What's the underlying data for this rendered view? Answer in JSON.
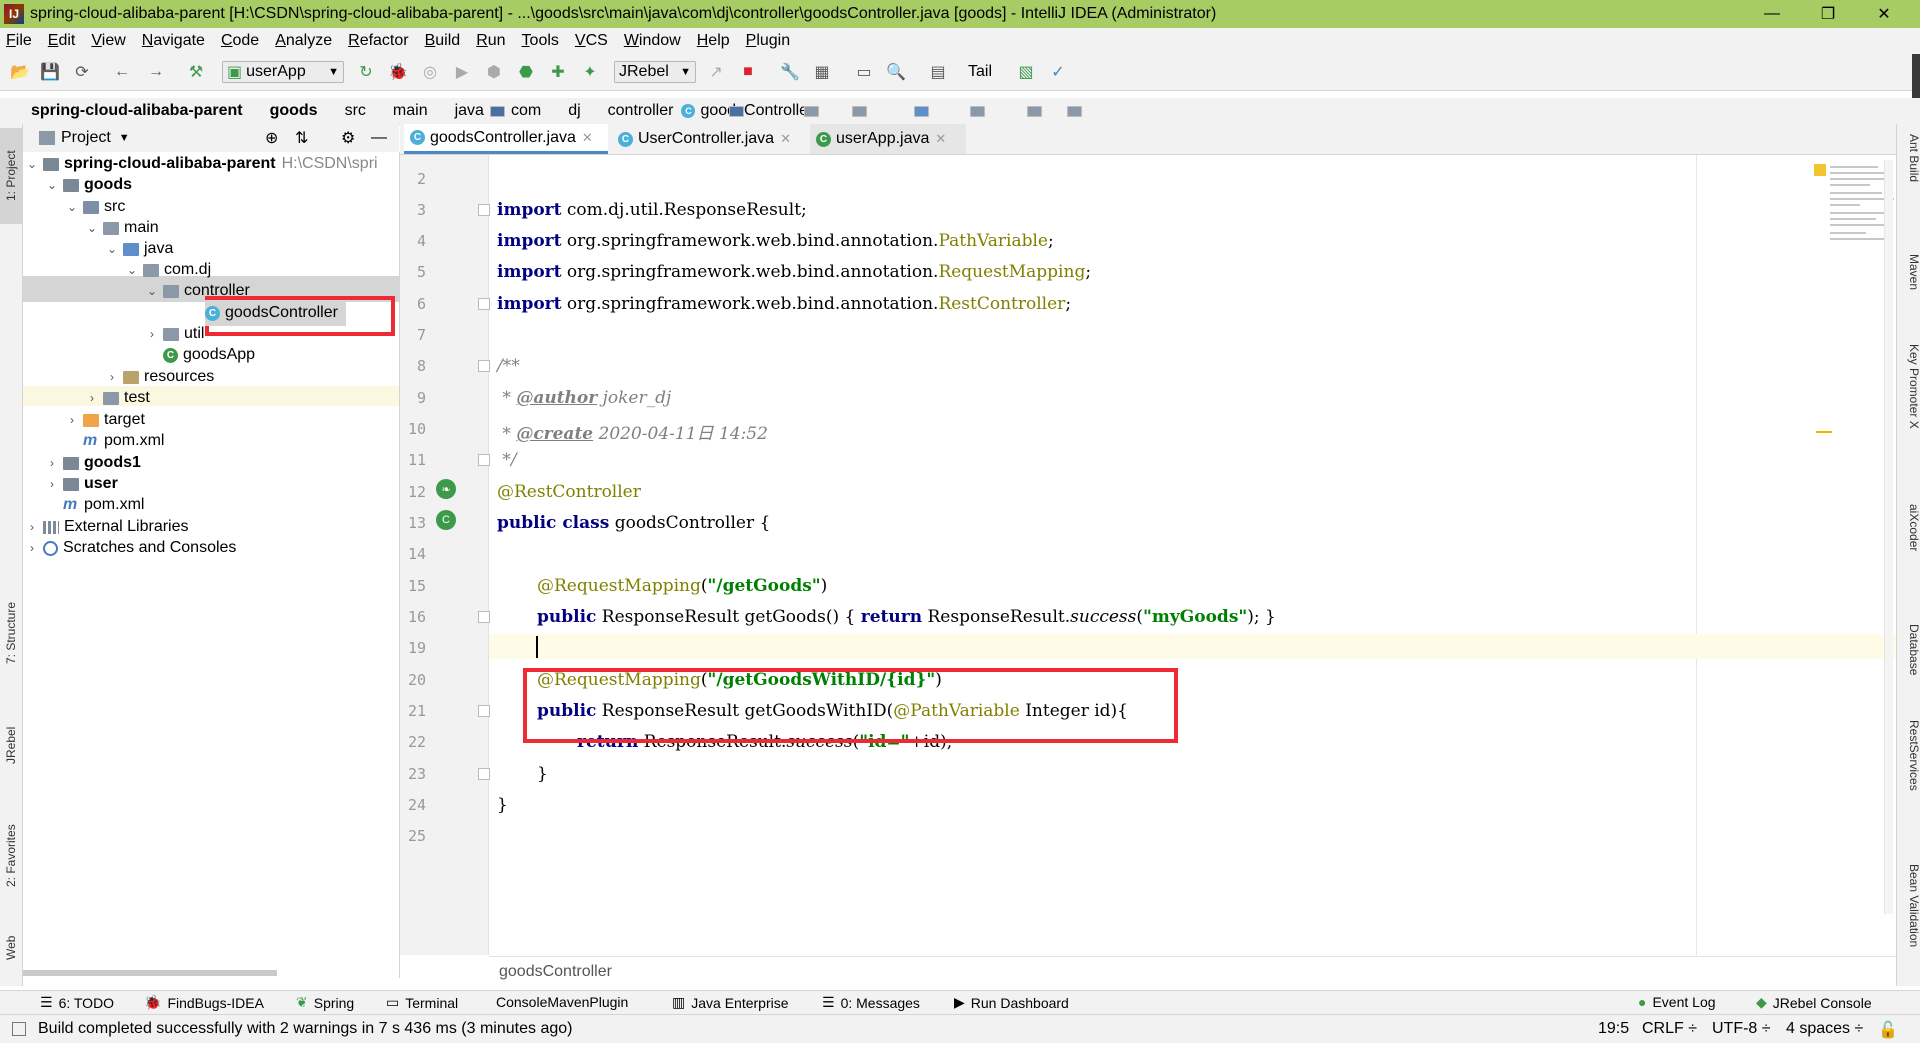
{
  "window": {
    "title": "spring-cloud-alibaba-parent [H:\\CSDN\\spring-cloud-alibaba-parent] - ...\\goods\\src\\main\\java\\com\\dj\\controller\\goodsController.java [goods] - IntelliJ IDEA (Administrator)",
    "app_icon": "IJ",
    "controls": [
      "—",
      "❐",
      "✕"
    ]
  },
  "menu": [
    "File",
    "Edit",
    "View",
    "Navigate",
    "Code",
    "Analyze",
    "Refactor",
    "Build",
    "Run",
    "Tools",
    "VCS",
    "Window",
    "Help",
    "Plugin"
  ],
  "toolbar": {
    "run_config": "userApp",
    "jrebel": "JRebel",
    "tail": "Tail"
  },
  "breadcrumb": [
    "spring-cloud-alibaba-parent",
    "goods",
    "src",
    "main",
    "java",
    "com",
    "dj",
    "controller",
    "goodsController"
  ],
  "project": {
    "header": "Project",
    "tree": [
      {
        "label": "spring-cloud-alibaba-parent",
        "hint": "H:\\CSDN\\spri",
        "bold": true
      },
      {
        "label": "goods",
        "bold": true
      },
      {
        "label": "src"
      },
      {
        "label": "main"
      },
      {
        "label": "java"
      },
      {
        "label": "com.dj"
      },
      {
        "label": "controller"
      },
      {
        "label": "goodsController"
      },
      {
        "label": "util"
      },
      {
        "label": "goodsApp"
      },
      {
        "label": "resources"
      },
      {
        "label": "test"
      },
      {
        "label": "target"
      },
      {
        "label": "pom.xml"
      },
      {
        "label": "goods1",
        "bold": true
      },
      {
        "label": "user",
        "bold": true
      },
      {
        "label": "pom.xml"
      },
      {
        "label": "External Libraries"
      },
      {
        "label": "Scratches and Consoles"
      }
    ]
  },
  "left_tabs": [
    "1: Project",
    "7: Structure",
    "JRebel",
    "2: Favorites",
    "Web"
  ],
  "right_tabs": [
    "Ant Build",
    "Maven",
    "Key Promoter X",
    "aiXcoder",
    "Database",
    "RestServices",
    "Bean Validation"
  ],
  "editor_tabs": [
    {
      "label": "goodsController.java",
      "active": true
    },
    {
      "label": "UserController.java",
      "active": false
    },
    {
      "label": "userApp.java",
      "active": false
    }
  ],
  "line_numbers": [
    "2",
    "3",
    "4",
    "5",
    "6",
    "7",
    "8",
    "9",
    "10",
    "11",
    "12",
    "13",
    "14",
    "15",
    "16",
    "19",
    "20",
    "21",
    "22",
    "23",
    "24",
    "25"
  ],
  "code": {
    "l3_kw": "import",
    "l3_rest": " com.dj.util.ResponseResult;",
    "l4_kw": "import",
    "l4_pre": " org.springframework.web.bind.annotation.",
    "l4_ann": "PathVariable",
    "l4_end": ";",
    "l5_kw": "import",
    "l5_pre": " org.springframework.web.bind.annotation.",
    "l5_ann": "RequestMapping",
    "l5_end": ";",
    "l6_kw": "import",
    "l6_pre": " org.springframework.web.bind.annotation.",
    "l6_ann": "RestController",
    "l6_end": ";",
    "l8": "/**",
    "l9_pre": " * ",
    "l9_tag": "@author",
    "l9_val": " joker_dj",
    "l10_pre": " * ",
    "l10_tag": "@create",
    "l10_val": " 2020-04-11日 14:52",
    "l11": " */",
    "l12": "@RestController",
    "l13_kw": "public class",
    "l13_rest": " goodsController {",
    "l15_ann": "@RequestMapping",
    "l15_p1": "(",
    "l15_str": "\"/getGoods\"",
    "l15_p2": ")",
    "l16_kw": "public",
    "l16_a": " ResponseResult getGoods() { ",
    "l16_kw2": "return",
    "l16_b": " ResponseResult.",
    "l16_it": "success",
    "l16_c": "(",
    "l16_str": "\"myGoods\"",
    "l16_d": "); }",
    "l20_ann": "@RequestMapping",
    "l20_p1": "(",
    "l20_str": "\"/getGoodsWithID/{id}\"",
    "l20_p2": ")",
    "l21_kw": "public",
    "l21_a": " ResponseResult getGoodsWithID(",
    "l21_ann": "@PathVariable",
    "l21_b": " Integer id){",
    "l22_kw": "return",
    "l22_a": " ResponseResult.",
    "l22_it": "success",
    "l22_b": "(",
    "l22_str": "\"id=\"",
    "l22_c": "+id);",
    "l23": "}",
    "l24": "}"
  },
  "editor_footer": "goodsController",
  "bottom_tabs": [
    "6: TODO",
    "FindBugs-IDEA",
    "Spring",
    "Terminal",
    "ConsoleMavenPlugin",
    "Java Enterprise",
    "0: Messages",
    "Run Dashboard",
    "Event Log",
    "JRebel Console"
  ],
  "status": {
    "message": "Build completed successfully with 2 warnings in 7 s 436 ms (3 minutes ago)",
    "position": "19:5",
    "line_sep": "CRLF ÷",
    "encoding": "UTF-8 ÷",
    "indent": "4 spaces ÷"
  },
  "colors": {
    "titlebar": "#a7cc63",
    "highlight_box": "#ee2b34",
    "keyword": "#000080",
    "annotation": "#808000",
    "string": "#008000"
  }
}
